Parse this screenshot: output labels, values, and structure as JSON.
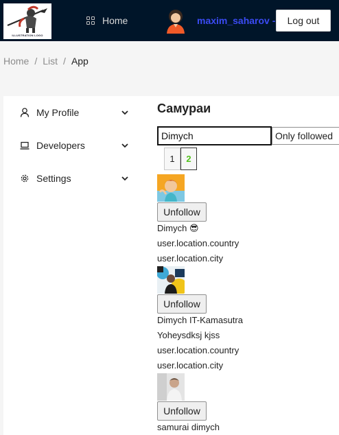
{
  "header": {
    "logo_text": "ILLUSTRATION LOGO",
    "nav_home": "Home",
    "username": "maxim_saharov -",
    "logout_label": "Log out"
  },
  "breadcrumb": [
    "Home",
    "List",
    "App"
  ],
  "sidebar": {
    "items": [
      {
        "label": "My Profile",
        "icon": "user-icon"
      },
      {
        "label": "Developers",
        "icon": "laptop-icon"
      },
      {
        "label": "Settings",
        "icon": "gear-icon"
      }
    ]
  },
  "main": {
    "title": "Самураи",
    "search_value": "Dimych",
    "filter_selected": "Only followed",
    "pages": [
      "1",
      "2"
    ],
    "active_page": "2",
    "users": [
      {
        "button": "Unfollow",
        "name": "Dimych 😎",
        "lines": [
          "user.location.country",
          "user.location.city"
        ]
      },
      {
        "button": "Unfollow",
        "name": "Dimych IT-Kamasutra",
        "lines": [
          "Yoheysdksj kjss",
          "user.location.country",
          "user.location.city"
        ]
      },
      {
        "button": "Unfollow",
        "name": "samurai dimych",
        "lines": []
      }
    ]
  },
  "colors": {
    "header_bg": "#001529",
    "username": "#3b4bf4",
    "active_page": "#53c21d"
  }
}
